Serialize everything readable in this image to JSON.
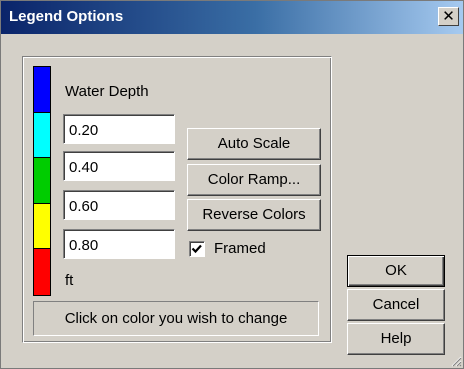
{
  "window": {
    "title": "Legend Options",
    "close_glyph": "✕"
  },
  "legend": {
    "title": "Water Depth",
    "unit": "ft",
    "colors": [
      "#0000ff",
      "#00ffff",
      "#00cc00",
      "#ffff00",
      "#ff0000"
    ],
    "values": [
      "0.20",
      "0.40",
      "0.60",
      "0.80"
    ],
    "hint": "Click on color you wish to change"
  },
  "buttons": {
    "auto_scale": "Auto Scale",
    "color_ramp": "Color Ramp...",
    "reverse_colors": "Reverse Colors",
    "ok": "OK",
    "cancel": "Cancel",
    "help": "Help"
  },
  "framed": {
    "label": "Framed",
    "checked": true
  }
}
